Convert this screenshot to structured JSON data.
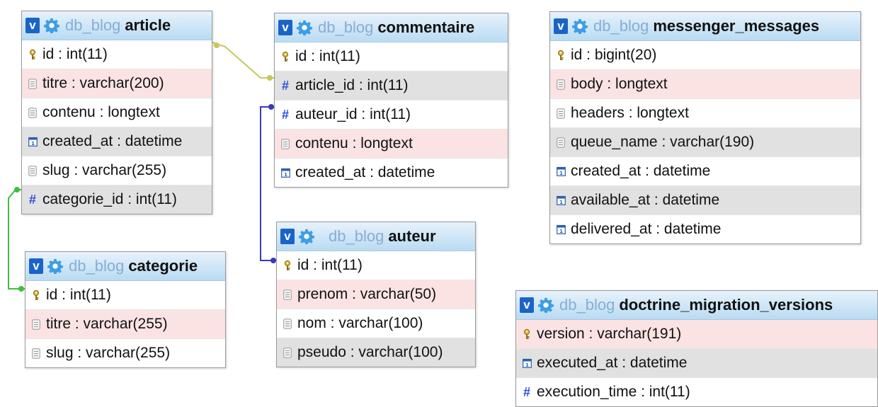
{
  "tables": [
    {
      "id": "article",
      "db": "db_blog",
      "name": "article",
      "columns": [
        {
          "label": "id : int(11)",
          "icon": "key-icon",
          "bg": "none"
        },
        {
          "label": "titre : varchar(200)",
          "icon": "text-icon",
          "bg": "pink"
        },
        {
          "label": "contenu : longtext",
          "icon": "text-icon",
          "bg": "none"
        },
        {
          "label": "created_at : datetime",
          "icon": "calendar-icon",
          "bg": "gray"
        },
        {
          "label": "slug : varchar(255)",
          "icon": "text-icon",
          "bg": "none"
        },
        {
          "label": "categorie_id : int(11)",
          "icon": "hash-icon",
          "bg": "gray"
        }
      ]
    },
    {
      "id": "commentaire",
      "db": "db_blog",
      "name": "commentaire",
      "columns": [
        {
          "label": "id : int(11)",
          "icon": "key-icon",
          "bg": "none"
        },
        {
          "label": "article_id : int(11)",
          "icon": "hash-icon",
          "bg": "gray"
        },
        {
          "label": "auteur_id : int(11)",
          "icon": "hash-icon",
          "bg": "none"
        },
        {
          "label": "contenu : longtext",
          "icon": "text-icon",
          "bg": "pink"
        },
        {
          "label": "created_at : datetime",
          "icon": "calendar-icon",
          "bg": "none"
        }
      ]
    },
    {
      "id": "messenger_messages",
      "db": "db_blog",
      "name": "messenger_messages",
      "columns": [
        {
          "label": "id : bigint(20)",
          "icon": "key-icon",
          "bg": "none"
        },
        {
          "label": "body : longtext",
          "icon": "text-icon",
          "bg": "pink"
        },
        {
          "label": "headers : longtext",
          "icon": "text-icon",
          "bg": "none"
        },
        {
          "label": "queue_name : varchar(190)",
          "icon": "text-icon",
          "bg": "gray"
        },
        {
          "label": "created_at : datetime",
          "icon": "calendar-icon",
          "bg": "none"
        },
        {
          "label": "available_at : datetime",
          "icon": "calendar-icon",
          "bg": "gray"
        },
        {
          "label": "delivered_at : datetime",
          "icon": "calendar-icon",
          "bg": "none"
        }
      ]
    },
    {
      "id": "categorie",
      "db": "db_blog",
      "name": "categorie",
      "columns": [
        {
          "label": "id : int(11)",
          "icon": "key-icon",
          "bg": "none"
        },
        {
          "label": "titre : varchar(255)",
          "icon": "text-icon",
          "bg": "pink"
        },
        {
          "label": "slug : varchar(255)",
          "icon": "text-icon",
          "bg": "none"
        }
      ]
    },
    {
      "id": "auteur",
      "db": "db_blog",
      "name": "auteur",
      "columns": [
        {
          "label": "id : int(11)",
          "icon": "key-icon",
          "bg": "none"
        },
        {
          "label": "prenom : varchar(50)",
          "icon": "text-icon",
          "bg": "pink"
        },
        {
          "label": "nom : varchar(100)",
          "icon": "text-icon",
          "bg": "none"
        },
        {
          "label": "pseudo : varchar(100)",
          "icon": "text-icon",
          "bg": "gray"
        }
      ]
    },
    {
      "id": "doctrine_migration_versions",
      "db": "db_blog",
      "name": "doctrine_migration_versions",
      "columns": [
        {
          "label": "version : varchar(191)",
          "icon": "key-icon",
          "bg": "pink"
        },
        {
          "label": "executed_at : datetime",
          "icon": "calendar-icon",
          "bg": "gray"
        },
        {
          "label": "execution_time : int(11)",
          "icon": "hash-icon",
          "bg": "none"
        }
      ]
    }
  ],
  "relations": [
    {
      "from": "commentaire.article_id",
      "to": "article.id",
      "color": "#c8c85a"
    },
    {
      "from": "commentaire.auteur_id",
      "to": "auteur.id",
      "color": "#3b3bb5"
    },
    {
      "from": "article.categorie_id",
      "to": "categorie.id",
      "color": "#3fbf3f"
    }
  ],
  "colors": {
    "header_db": "#86aed3",
    "v_badge": "#1a64c8",
    "gear": "#3d9ee6",
    "hash": "#2b4fe0",
    "row_pink": "#fbe3e3",
    "row_gray": "#e1e1e1"
  }
}
